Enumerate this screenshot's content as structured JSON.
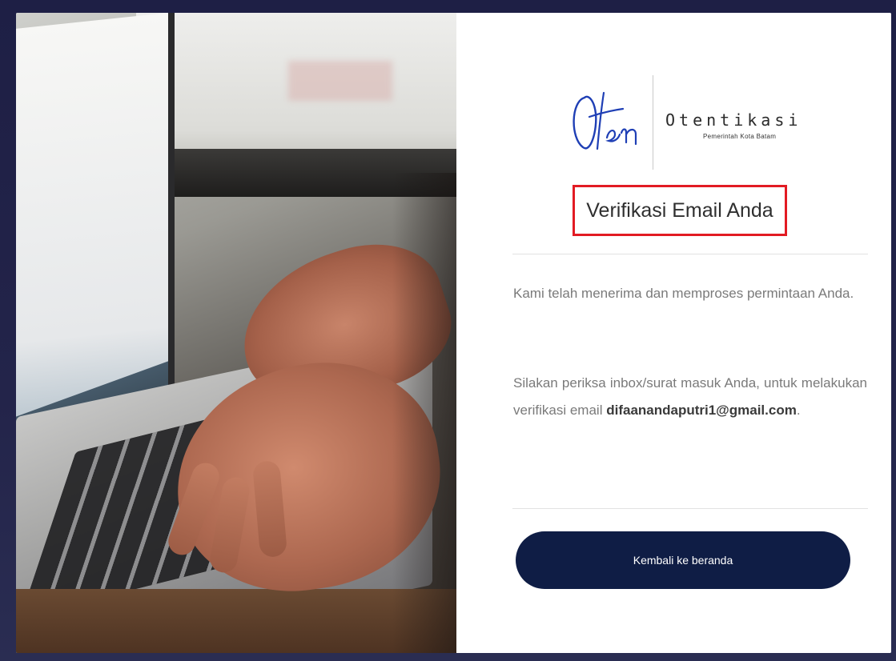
{
  "brand": {
    "logo_script": "Oten",
    "name": "Otentikasi",
    "subtitle": "Pemerintah Kota Batam",
    "color": "#1f3fb5"
  },
  "heading": {
    "title": "Verifikasi Email Anda",
    "highlight_color": "#e21b23"
  },
  "message": {
    "paragraph1": "Kami telah menerima dan memproses permintaan Anda.",
    "paragraph2_prefix": "Silakan periksa inbox/surat masuk Anda, untuk melakukan verifikasi email",
    "email": "difaanandaputri1@gmail.com",
    "paragraph2_suffix": "."
  },
  "actions": {
    "back_button_label": "Kembali ke beranda",
    "button_color": "#0f1d45"
  },
  "hero_image": {
    "icon": "laptop-typing-photo"
  }
}
